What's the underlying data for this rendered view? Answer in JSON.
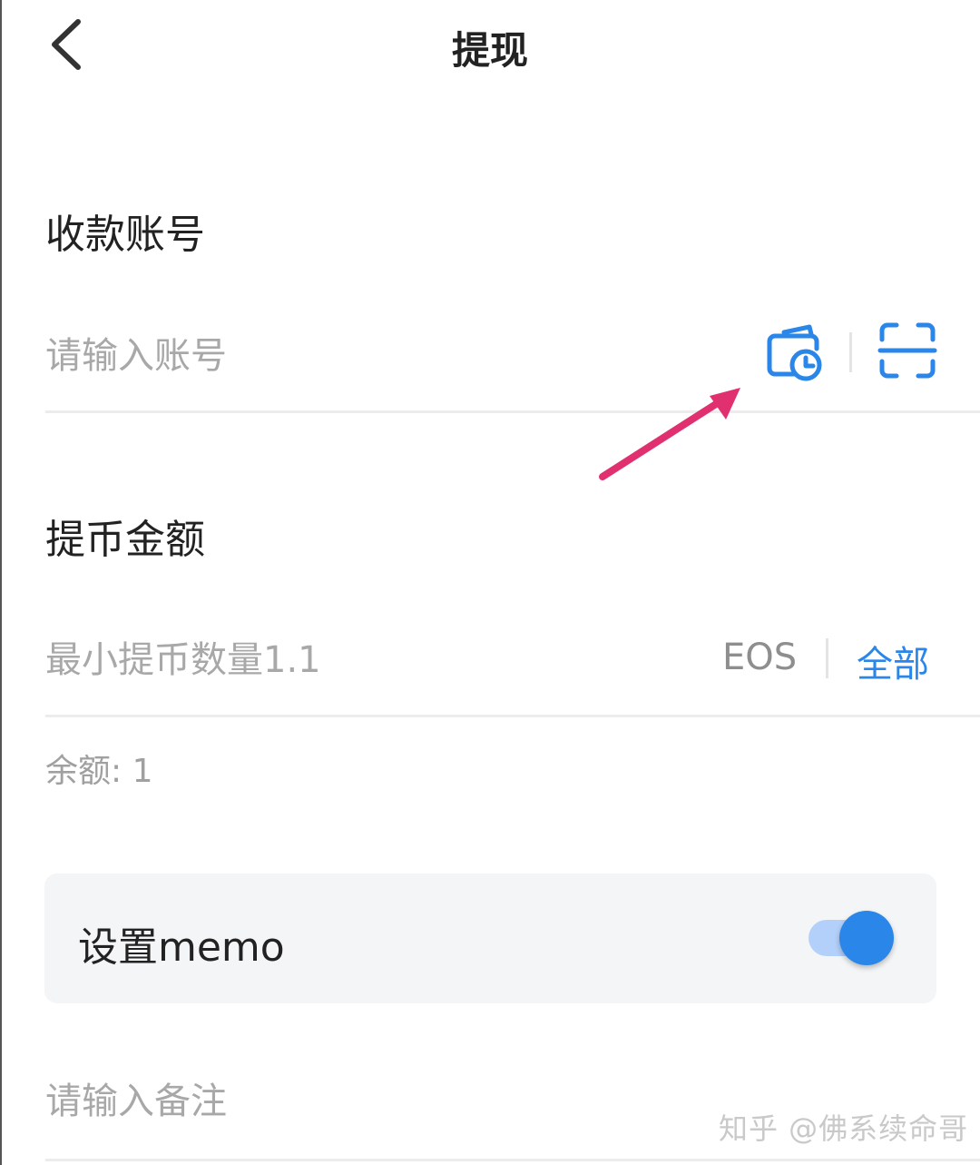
{
  "header": {
    "title": "提现",
    "back_icon": "chevron-left-icon"
  },
  "account": {
    "label": "收款账号",
    "placeholder": "请输入账号",
    "address_book_icon": "wallet-clock-icon",
    "scan_icon": "scan-icon"
  },
  "amount": {
    "label": "提币金额",
    "placeholder": "最小提币数量1.1",
    "unit": "EOS",
    "all_label": "全部"
  },
  "balance_text": "余额: 1",
  "memo": {
    "label": "设置memo",
    "toggle_on": true,
    "placeholder": "请输入备注"
  },
  "watermark": "知乎 @佛系续命哥",
  "colors": {
    "accent": "#2a86e8",
    "annotation_arrow": "#e0306f"
  }
}
